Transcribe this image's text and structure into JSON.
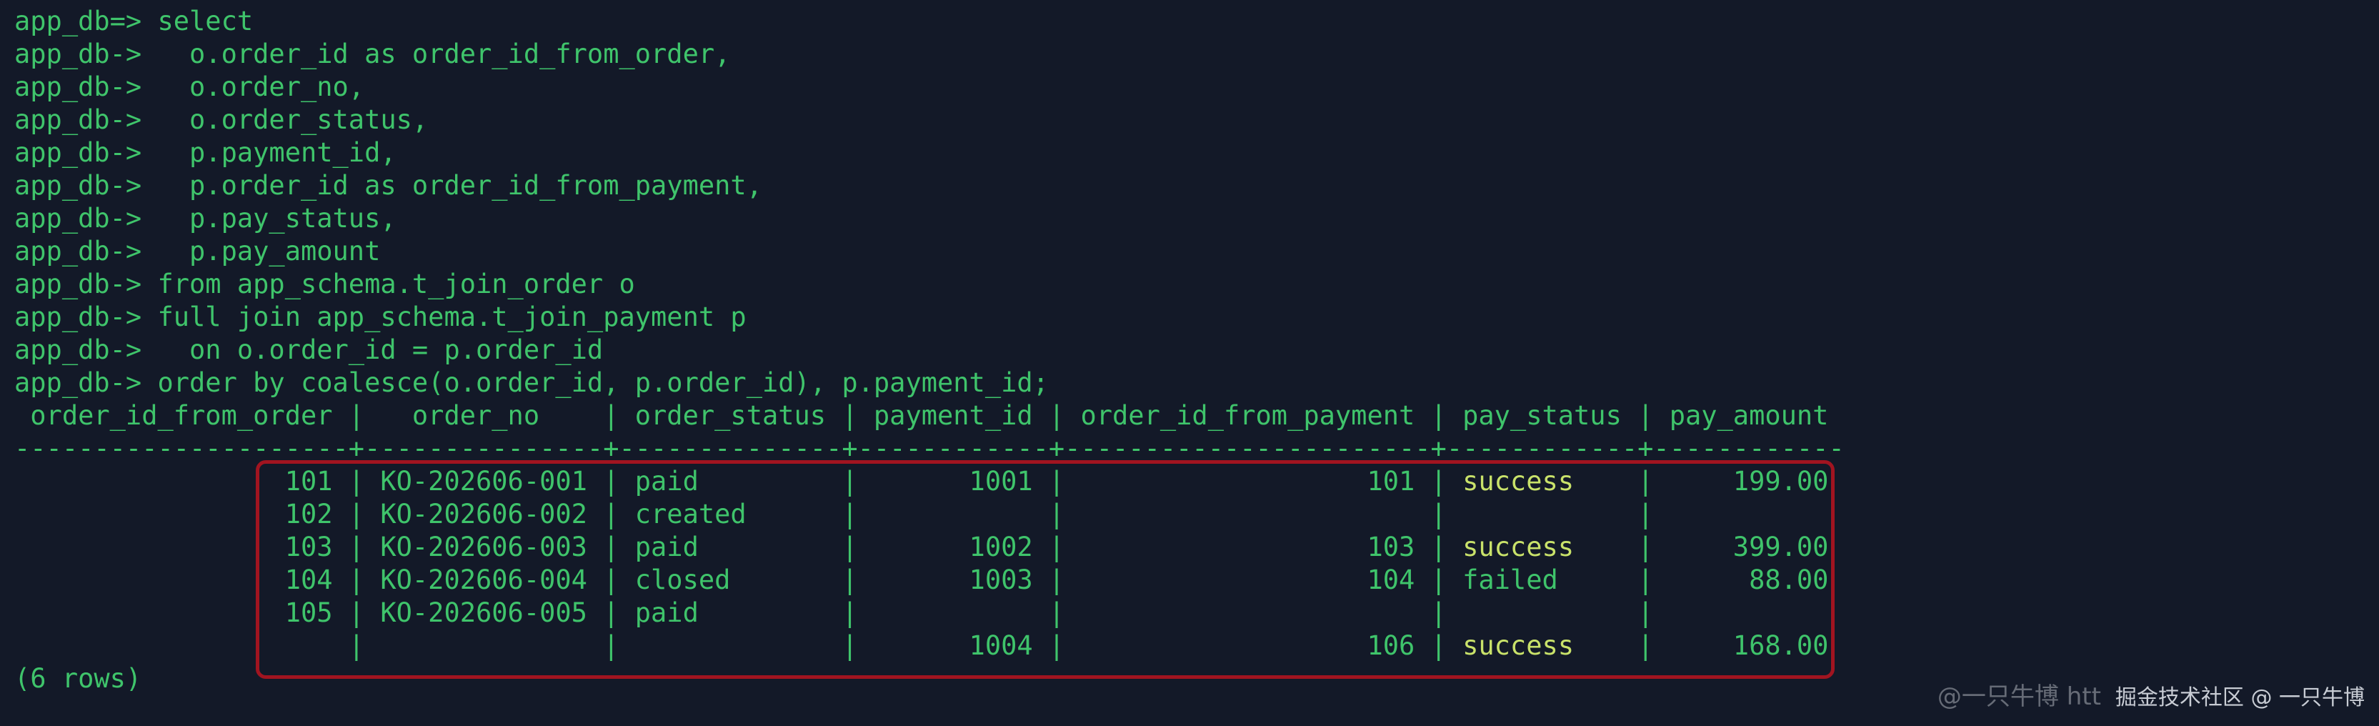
{
  "terminal": {
    "lines": [
      "app_db=> select",
      "app_db->   o.order_id as order_id_from_order,",
      "app_db->   o.order_no,",
      "app_db->   o.order_status,",
      "app_db->   p.payment_id,",
      "app_db->   p.order_id as order_id_from_payment,",
      "app_db->   p.pay_status,",
      "app_db->   p.pay_amount",
      "app_db-> from app_schema.t_join_order o",
      "app_db-> full join app_schema.t_join_payment p",
      "app_db->   on o.order_id = p.order_id",
      "app_db-> order by coalesce(o.order_id, p.order_id), p.payment_id;",
      " order_id_from_order |   order_no    | order_status | payment_id | order_id_from_payment | pay_status | pay_amount",
      "---------------------+---------------+--------------+------------+-----------------------+------------+------------"
    ],
    "rows": [
      {
        "pre": "                 101 | KO-202606-001 | paid         |       1001 |                   101 | ",
        "status": "success",
        "post": "    |     199.00"
      },
      {
        "pre": "                 102 | KO-202606-002 | created      |            |                       | ",
        "status": "",
        "post": "           |"
      },
      {
        "pre": "                 103 | KO-202606-003 | paid         |       1002 |                   103 | ",
        "status": "success",
        "post": "    |     399.00"
      },
      {
        "pre": "                 104 | KO-202606-004 | closed       |       1003 |                   104 | ",
        "status": "failed",
        "post": "     |      88.00"
      },
      {
        "pre": "                 105 | KO-202606-005 | paid         |            |                       | ",
        "status": "",
        "post": "           |"
      },
      {
        "pre": "                     |               |              |       1004 |                   106 | ",
        "status": "success",
        "post": "    |     168.00"
      }
    ],
    "footer": "(6 rows)"
  },
  "watermark": {
    "under": "@一只牛博 htt",
    "text": "掘金技术社区 @ 一只牛博"
  },
  "colors": {
    "background": "#131928",
    "text": "#3fc46b",
    "success": "#c9e26a",
    "highlight_border": "#a11420"
  }
}
